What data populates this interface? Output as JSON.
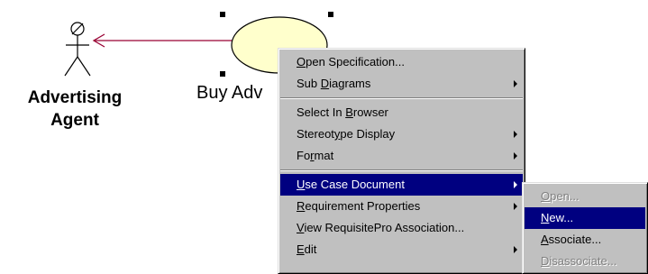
{
  "diagram": {
    "actor_label_line1": "Advertising",
    "actor_label_line2": "Agent",
    "use_case_label": "Buy Adv"
  },
  "context_menu": {
    "items": [
      {
        "pre": "",
        "key": "O",
        "post": "pen Specification...",
        "submenu": false
      },
      {
        "pre": "Sub ",
        "key": "D",
        "post": "iagrams",
        "submenu": true
      },
      {
        "pre": "Select In ",
        "key": "B",
        "post": "rowser",
        "submenu": false
      },
      {
        "pre": "Stereot",
        "key": "y",
        "post": "pe Display",
        "submenu": true
      },
      {
        "pre": "Fo",
        "key": "r",
        "post": "mat",
        "submenu": true
      },
      {
        "pre": "",
        "key": "U",
        "post": "se Case Document",
        "submenu": true,
        "selected": true
      },
      {
        "pre": "",
        "key": "R",
        "post": "equirement Properties",
        "submenu": true
      },
      {
        "pre": "",
        "key": "V",
        "post": "iew RequisitePro Association...",
        "submenu": false
      },
      {
        "pre": "",
        "key": "E",
        "post": "dit",
        "submenu": true
      }
    ]
  },
  "submenu": {
    "items": [
      {
        "pre": "",
        "key": "O",
        "post": "pen...",
        "disabled": true
      },
      {
        "pre": "",
        "key": "N",
        "post": "ew...",
        "selected": true
      },
      {
        "pre": "",
        "key": "A",
        "post": "ssociate...",
        "disabled": false
      },
      {
        "pre": "",
        "key": "D",
        "post": "isassociate...",
        "disabled": true
      }
    ]
  },
  "colors": {
    "menu_bg": "#c0c0c0",
    "selection": "#000080",
    "use_case_fill": "#ffffcc",
    "association_line": "#990033"
  }
}
